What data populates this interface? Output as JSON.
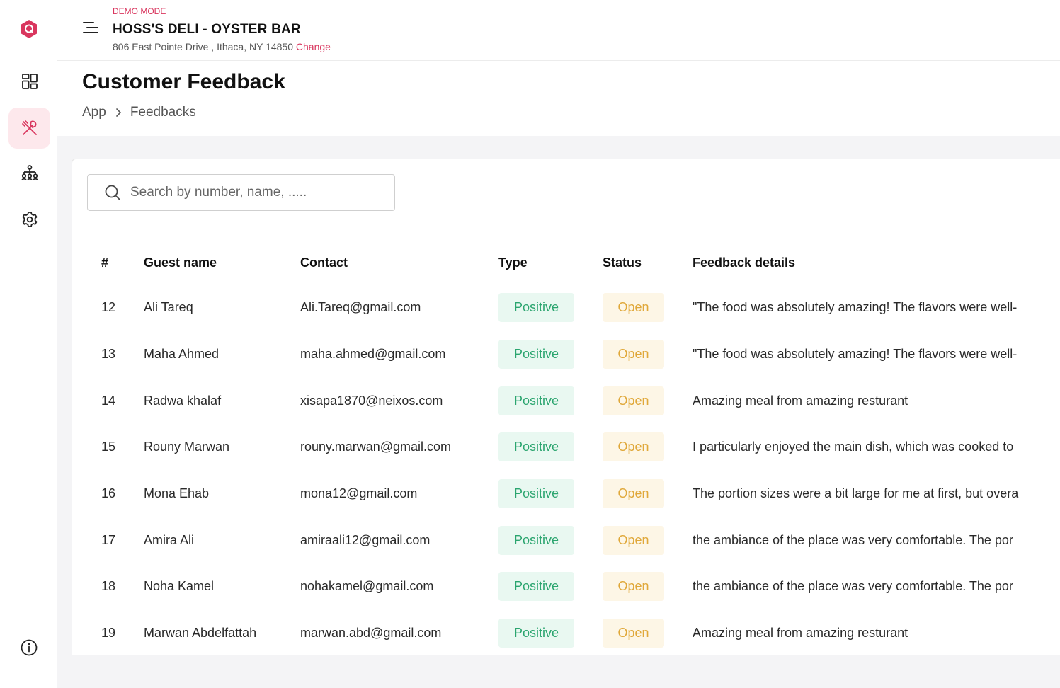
{
  "app": {
    "demo_label": "DEMO MODE",
    "brand_color": "#d9365e"
  },
  "header": {
    "restaurant_name": "HOSS'S DELI - OYSTER BAR",
    "address": "806 East Pointe Drive , Ithaca, NY 14850",
    "change_label": "Change"
  },
  "sidebar": {
    "items": [
      {
        "icon": "dashboard-icon",
        "active": false
      },
      {
        "icon": "utensils-icon",
        "active": true
      },
      {
        "icon": "hierarchy-icon",
        "active": false
      },
      {
        "icon": "gear-icon",
        "active": false
      }
    ],
    "bottom_icon": "info-icon"
  },
  "page": {
    "title": "Customer Feedback",
    "breadcrumb": [
      "App",
      "Feedbacks"
    ]
  },
  "search": {
    "placeholder": "Search by number, name, ....."
  },
  "table": {
    "headers": [
      "#",
      "Guest name",
      "Contact",
      "Type",
      "Status",
      "Feedback details"
    ],
    "rows": [
      {
        "num": "12",
        "name": "Ali Tareq",
        "contact": "Ali.Tareq@gmail.com",
        "type": "Positive",
        "status": "Open",
        "details": "\"The food was absolutely amazing! The flavors were well-"
      },
      {
        "num": "13",
        "name": "Maha Ahmed",
        "contact": "maha.ahmed@gmail.com",
        "type": "Positive",
        "status": "Open",
        "details": "\"The food was absolutely amazing! The flavors were well-"
      },
      {
        "num": "14",
        "name": "Radwa khalaf",
        "contact": "xisapa1870@neixos.com",
        "type": "Positive",
        "status": "Open",
        "details": "Amazing meal from amazing resturant"
      },
      {
        "num": "15",
        "name": "Rouny Marwan",
        "contact": "rouny.marwan@gmail.com",
        "type": "Positive",
        "status": "Open",
        "details": "I particularly enjoyed the main dish, which was cooked to"
      },
      {
        "num": "16",
        "name": "Mona Ehab",
        "contact": "mona12@gmail.com",
        "type": "Positive",
        "status": "Open",
        "details": "The portion sizes were a bit large for me at first, but overa"
      },
      {
        "num": "17",
        "name": "Amira Ali",
        "contact": "amiraali12@gmail.com",
        "type": "Positive",
        "status": "Open",
        "details": "the ambiance of the place was very comfortable. The por"
      },
      {
        "num": "18",
        "name": "Noha Kamel",
        "contact": "nohakamel@gmail.com",
        "type": "Positive",
        "status": "Open",
        "details": "the ambiance of the place was very comfortable. The por"
      },
      {
        "num": "19",
        "name": "Marwan Abdelfattah",
        "contact": "marwan.abd@gmail.com",
        "type": "Positive",
        "status": "Open",
        "details": "Amazing meal from amazing resturant"
      }
    ]
  }
}
